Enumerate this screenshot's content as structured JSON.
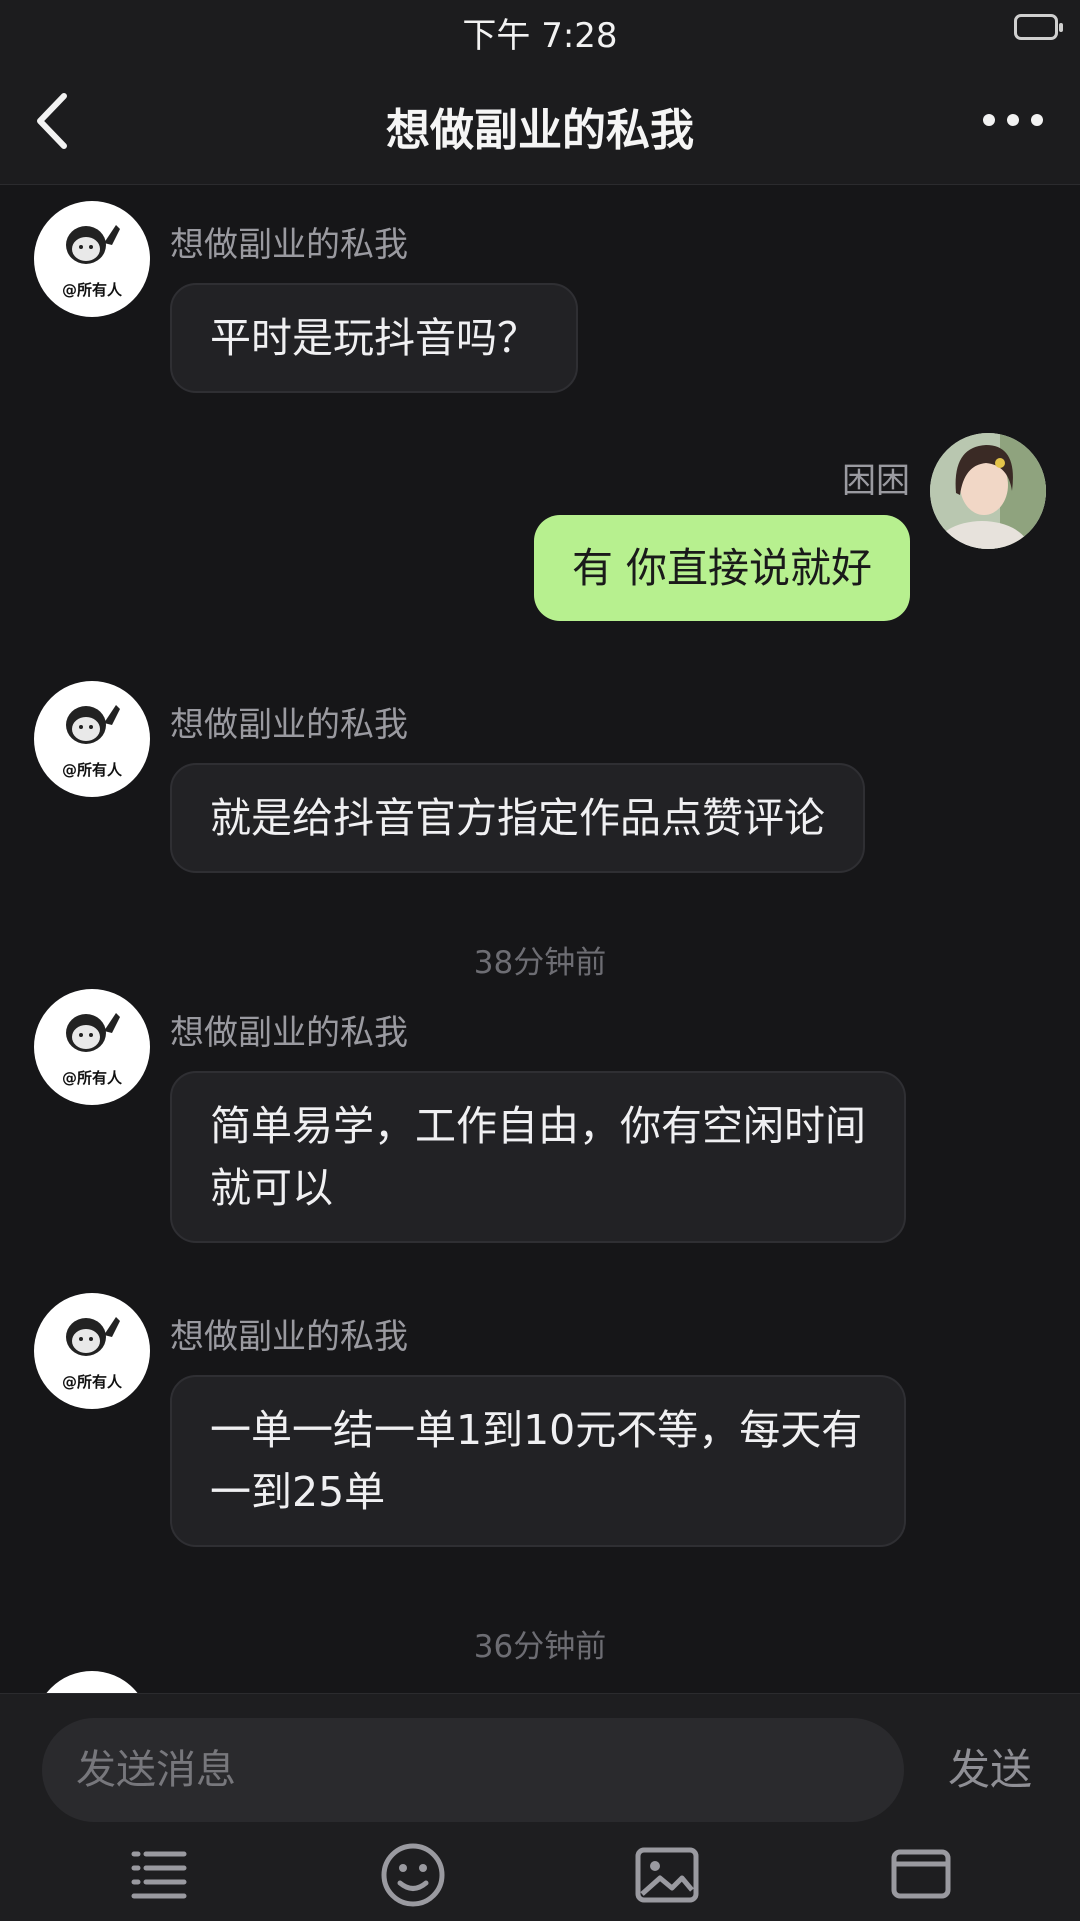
{
  "status_bar": {
    "time": "下午 7:28"
  },
  "header": {
    "title": "想做副业的私我"
  },
  "contact": {
    "name": "想做副业的私我",
    "avatar_caption": "@所有人"
  },
  "me": {
    "name": "困困"
  },
  "messages": [
    {
      "from": "contact",
      "name": "想做副业的私我",
      "text": "平时是玩抖音吗？"
    },
    {
      "from": "me",
      "name": "困困",
      "text": "有   你直接说就好"
    },
    {
      "from": "contact",
      "name": "想做副业的私我",
      "text": "就是给抖音官方指定作品点赞评论"
    },
    {
      "timestamp": "38分钟前"
    },
    {
      "from": "contact",
      "name": "想做副业的私我",
      "text": "简单易学，工作自由，你有空闲时间就可以"
    },
    {
      "from": "contact",
      "name": "想做副业的私我",
      "text": "一单一结一单1到10元不等，每天有一到25单"
    },
    {
      "timestamp": "36分钟前"
    }
  ],
  "composer": {
    "placeholder": "发送消息",
    "send_label": "发送"
  },
  "toolbar_icons": [
    "list-icon",
    "emoji-icon",
    "image-icon",
    "card-icon"
  ],
  "colors": {
    "background": "#161618",
    "my_bubble": "#b7f08f",
    "contact_bubble": "#222225"
  }
}
